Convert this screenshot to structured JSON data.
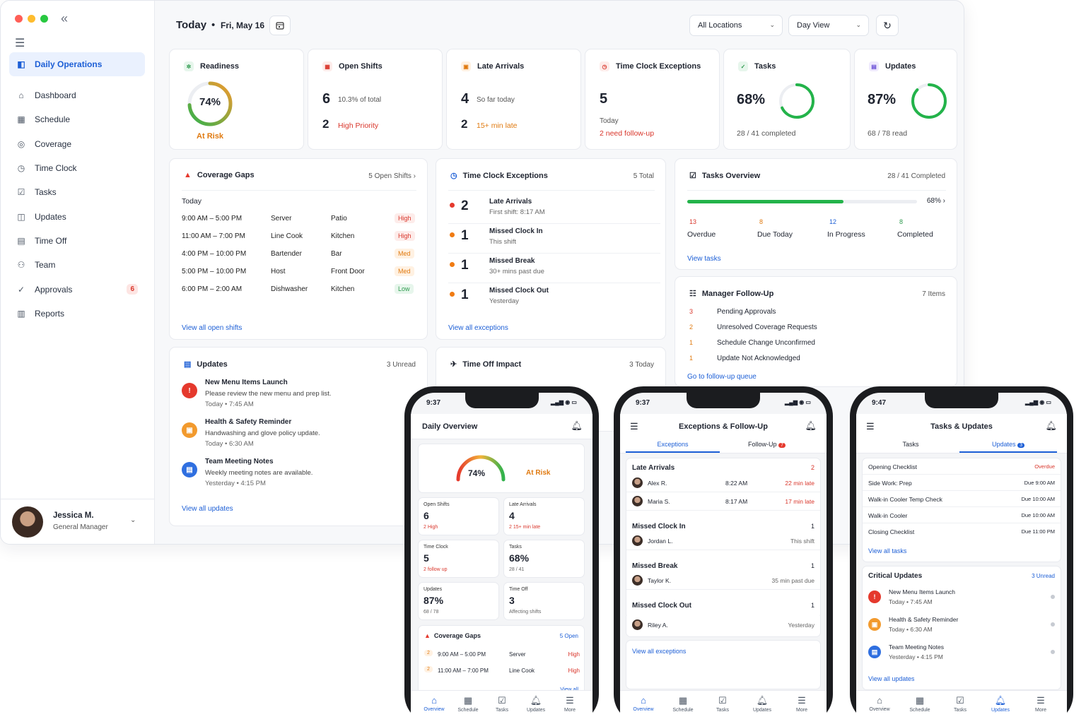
{
  "sidebar": {
    "items": [
      {
        "label": "Daily Operations",
        "icon": "daily-ops-icon"
      },
      {
        "label": "Dashboard",
        "icon": "home-icon"
      },
      {
        "label": "Schedule",
        "icon": "calendar-icon"
      },
      {
        "label": "Coverage",
        "icon": "coverage-icon"
      },
      {
        "label": "Time Clock",
        "icon": "clock-icon"
      },
      {
        "label": "Tasks",
        "icon": "checkbox-icon"
      },
      {
        "label": "Updates",
        "icon": "updates-icon"
      },
      {
        "label": "Time Off",
        "icon": "calendar-off-icon"
      },
      {
        "label": "Team",
        "icon": "team-icon"
      },
      {
        "label": "Approvals",
        "icon": "approvals-icon",
        "badge": "6"
      },
      {
        "label": "Reports",
        "icon": "reports-icon"
      }
    ],
    "user": {
      "name": "Jessica M.",
      "role": "General Manager"
    }
  },
  "header": {
    "title": "Today",
    "dot": "•",
    "date": "Fri, May 16",
    "location": "All Locations",
    "view": "Day View"
  },
  "stats": {
    "readiness": {
      "title": "Readiness",
      "value": "74%",
      "status": "At Risk",
      "level": 0.74
    },
    "open_shifts": {
      "title": "Open Shifts",
      "count": "6",
      "count_note": "10.3% of total",
      "priority": "2",
      "priority_note": "High Priority"
    },
    "late": {
      "title": "Late Arrivals",
      "count": "4",
      "count_note": "So far today",
      "late": "2",
      "late_note": "15+ min late"
    },
    "exceptions": {
      "title": "Time Clock Exceptions",
      "count": "5",
      "note": "Today",
      "follow": "2 need follow-up"
    },
    "tasks": {
      "title": "Tasks",
      "value": "68%",
      "note": "28 / 41 completed",
      "level": 0.68
    },
    "updates": {
      "title": "Updates",
      "value": "87%",
      "note": "68 / 78 read",
      "level": 0.87
    }
  },
  "coverage": {
    "title": "Coverage Gaps",
    "right": "5 Open Shifts ›",
    "day": "Today",
    "link": "View all open shifts",
    "rows": [
      {
        "time": "9:00 AM – 5:00 PM",
        "role": "Server",
        "area": "Patio",
        "pri": "High"
      },
      {
        "time": "11:00 AM – 7:00 PM",
        "role": "Line Cook",
        "area": "Kitchen",
        "pri": "High"
      },
      {
        "time": "4:00 PM – 10:00 PM",
        "role": "Bartender",
        "area": "Bar",
        "pri": "Med"
      },
      {
        "time": "5:00 PM – 10:00 PM",
        "role": "Host",
        "area": "Front Door",
        "pri": "Med"
      },
      {
        "time": "6:00 PM – 2:00 AM",
        "role": "Dishwasher",
        "area": "Kitchen",
        "pri": "Low"
      }
    ]
  },
  "tce": {
    "title": "Time Clock Exceptions",
    "right": "5 Total",
    "link": "View all exceptions",
    "rows": [
      {
        "n": "2",
        "label": "Late Arrivals",
        "sub": "First shift: 8:17 AM",
        "color": "#e5392d"
      },
      {
        "n": "1",
        "label": "Missed Clock In",
        "sub": "This shift",
        "color": "#f07b13"
      },
      {
        "n": "1",
        "label": "Missed Break",
        "sub": "30+ mins past due",
        "color": "#f07b13"
      },
      {
        "n": "1",
        "label": "Missed Clock Out",
        "sub": "Yesterday",
        "color": "#f07b13"
      }
    ]
  },
  "tasks_overview": {
    "title": "Tasks Overview",
    "right": "28 / 41 Completed",
    "pct": "68% ›",
    "level": 0.68,
    "link": "View tasks",
    "stats": [
      {
        "n": "13",
        "label": "Overdue",
        "color": "#d9362b"
      },
      {
        "n": "8",
        "label": "Due Today",
        "color": "#e07a10"
      },
      {
        "n": "12",
        "label": "In Progress",
        "color": "#1d5fd6"
      },
      {
        "n": "8",
        "label": "Completed",
        "color": "#2f9a4f"
      }
    ]
  },
  "followup": {
    "title": "Manager Follow-Up",
    "right": "7 Items",
    "link": "Go to follow-up queue",
    "rows": [
      {
        "n": "3",
        "label": "Pending Approvals",
        "color": "#d9362b"
      },
      {
        "n": "2",
        "label": "Unresolved Coverage Requests",
        "color": "#e07a10"
      },
      {
        "n": "1",
        "label": "Schedule Change Unconfirmed",
        "color": "#e07a10"
      },
      {
        "n": "1",
        "label": "Update Not Acknowledged",
        "color": "#e07a10"
      }
    ]
  },
  "updates_card": {
    "title": "Updates",
    "right": "3 Unread",
    "link": "View all updates",
    "rows": [
      {
        "title": "New Menu Items Launch",
        "body": "Please review the new menu and prep list.",
        "meta": "Today  •  7:45 AM",
        "icon": "!",
        "color": "#e5392d"
      },
      {
        "title": "Health & Safety Reminder",
        "body": "Handwashing and glove policy update.",
        "meta": "Today  •  6:30 AM",
        "icon": "▣",
        "color": "#f29a2e"
      },
      {
        "title": "Team Meeting Notes",
        "body": "Weekly meeting notes are available.",
        "meta": "Yesterday  •  4:15 PM",
        "icon": "▤",
        "color": "#2f6fe0"
      }
    ]
  },
  "timeoff": {
    "title": "Time Off Impact",
    "right": "3 Today"
  },
  "phone1": {
    "time": "9:37",
    "title": "Daily Overview",
    "gauge": "74%",
    "status": "At Risk",
    "tiles": [
      {
        "t": "Open Shifts",
        "v": "6",
        "s": "2 High",
        "red": true
      },
      {
        "t": "Late Arrivals",
        "v": "4",
        "s": "2 15+ min late",
        "red": true
      },
      {
        "t": "Time Clock",
        "v": "5",
        "s": "2 follow up",
        "red": true
      },
      {
        "t": "Tasks",
        "v": "68%",
        "s": "28 / 41",
        "red": false
      },
      {
        "t": "Updates",
        "v": "87%",
        "s": "68 / 78",
        "red": false
      },
      {
        "t": "Time Off",
        "v": "3",
        "s": "Affecting shifts",
        "red": false
      }
    ],
    "cov_title": "Coverage Gaps",
    "cov_right": "5 Open",
    "cov_rows": [
      {
        "n": "2",
        "time": "9:00 AM – 5:00 PM",
        "role": "Server",
        "pri": "High"
      },
      {
        "n": "2",
        "time": "11:00 AM – 7:00 PM",
        "role": "Line Cook",
        "pri": "High"
      }
    ],
    "view_all": "View all"
  },
  "phone2": {
    "time": "9:37",
    "title": "Exceptions & Follow-Up",
    "tab1": "Exceptions",
    "tab2": "Follow-Up",
    "tab2_badge": "7",
    "late_title": "Late Arrivals",
    "late_n": "2",
    "late_rows": [
      {
        "name": "Alex R.",
        "time": "8:22 AM",
        "late": "22 min late"
      },
      {
        "name": "Maria S.",
        "time": "8:17 AM",
        "late": "17 min late"
      }
    ],
    "mci": "Missed Clock In",
    "mci_n": "1",
    "mci_name": "Jordan L.",
    "mci_note": "This shift",
    "mb": "Missed Break",
    "mb_n": "1",
    "mb_name": "Taylor K.",
    "mb_note": "35 min past due",
    "mco": "Missed Clock Out",
    "mco_n": "1",
    "mco_name": "Riley A.",
    "mco_note": "Yesterday",
    "link": "View all exceptions"
  },
  "phone3": {
    "time": "9:47",
    "title": "Tasks & Updates",
    "tab1": "Tasks",
    "tab2": "Updates",
    "tab2_badge": "3",
    "tasks": [
      {
        "name": "Opening Checklist",
        "due": "Overdue",
        "red": true
      },
      {
        "name": "Side Work: Prep",
        "due": "Due 9:00 AM",
        "red": false
      },
      {
        "name": "Walk-in Cooler Temp Check",
        "due": "Due 10:00 AM",
        "red": false
      },
      {
        "name": "Walk-in Cooler",
        "due": "Due 10:00 AM",
        "red": false
      },
      {
        "name": "Closing Checklist",
        "due": "Due 11:00 PM",
        "red": false
      }
    ],
    "tasks_link": "View all tasks",
    "crit": "Critical Updates",
    "crit_right": "3 Unread",
    "updates": [
      {
        "title": "New Menu Items Launch",
        "meta": "Today  •  7:45 AM",
        "icon": "!",
        "color": "#e5392d"
      },
      {
        "title": "Health & Safety Reminder",
        "meta": "Today  •  6:30 AM",
        "icon": "▣",
        "color": "#f29a2e"
      },
      {
        "title": "Team Meeting Notes",
        "meta": "Yesterday  •  4:15 PM",
        "icon": "▤",
        "color": "#2f6fe0"
      }
    ],
    "updates_link": "View all updates"
  },
  "tabbar": {
    "items": [
      "Overview",
      "Schedule",
      "Tasks",
      "Updates",
      "More"
    ]
  }
}
